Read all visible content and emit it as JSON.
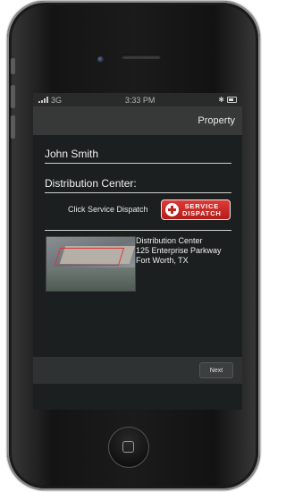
{
  "status_bar": {
    "carrier": "3G",
    "time": "3:33 PM"
  },
  "nav": {
    "title": "Property"
  },
  "content": {
    "name": "John Smith",
    "section_title": "Distribution Center:",
    "dispatch_prompt": "Click Service Dispatch",
    "dispatch_button": {
      "line1": "SERVICE",
      "line2": "DISPATCH"
    },
    "address": {
      "line1": "Distribution Center",
      "line2": "125 Enterprise Parkway",
      "line3": "Fort Worth, TX"
    }
  },
  "bottom": {
    "next_label": "Next"
  },
  "icons": {
    "signal": "signal-bars-icon",
    "bluetooth": "bluetooth-icon",
    "battery": "battery-icon",
    "cross": "medical-cross-icon",
    "home": "home-square-icon"
  },
  "colors": {
    "accent": "#c42420",
    "screen_bg": "#1b1f1f",
    "nav_bg": "#373939"
  }
}
